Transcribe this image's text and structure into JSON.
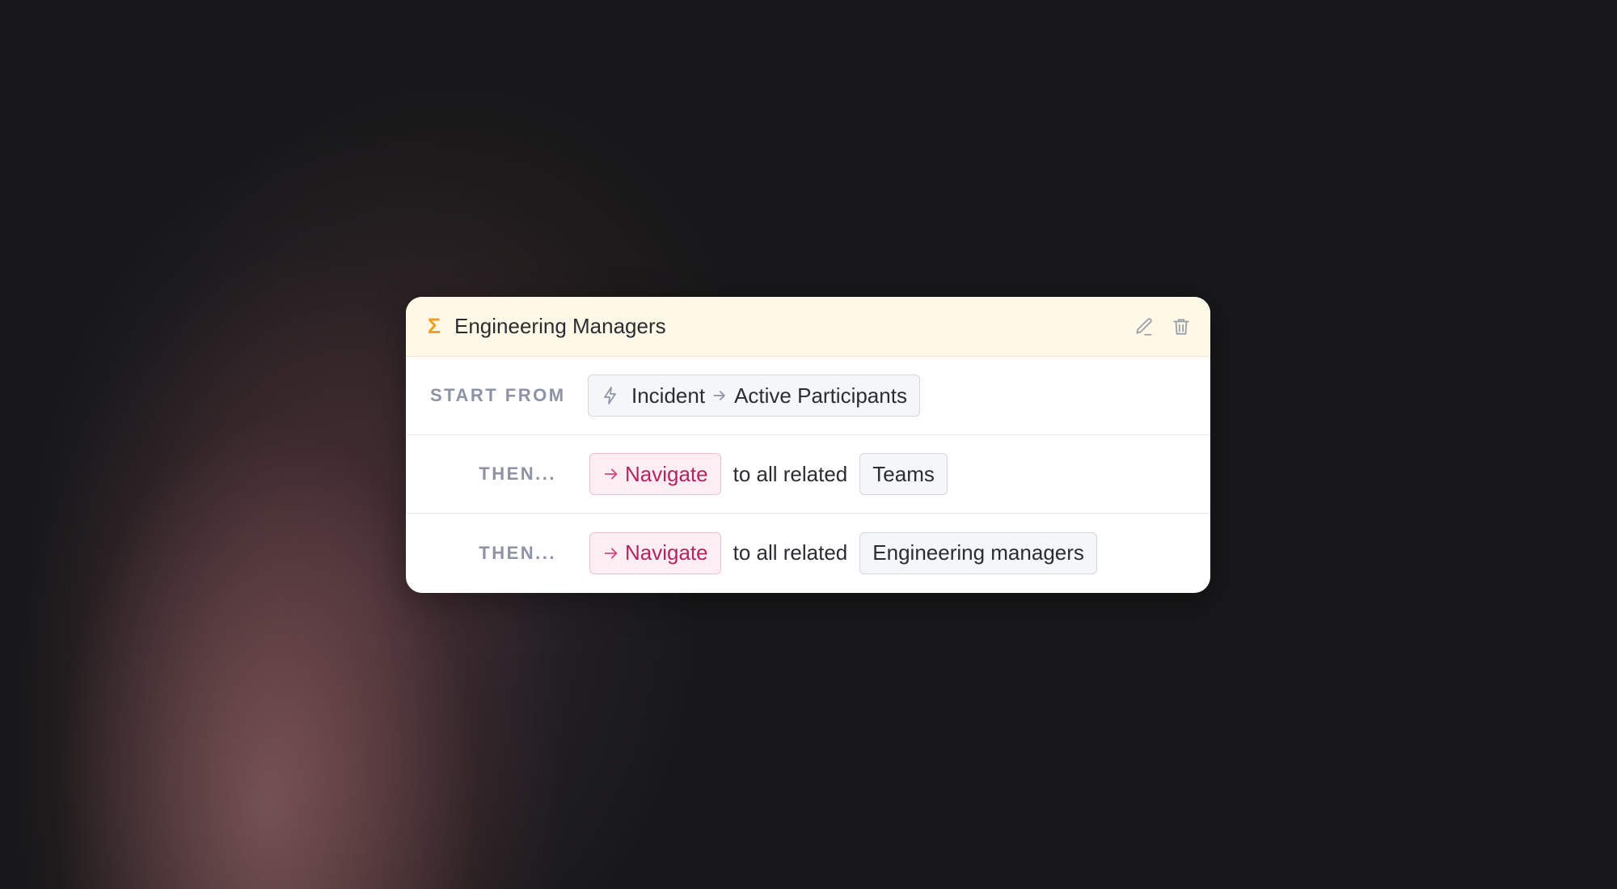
{
  "card": {
    "title": "Engineering Managers",
    "icons": {
      "title_icon": "sigma-icon",
      "edit": "pencil-icon",
      "delete": "trash-icon"
    }
  },
  "start": {
    "label": "START FROM",
    "source_icon": "lightning-bolt-icon",
    "source": "Incident",
    "arrow_icon": "arrow-right-icon",
    "target": "Active Participants"
  },
  "steps": [
    {
      "label": "THEN...",
      "action": "Navigate",
      "connector": "to all related",
      "target": "Teams"
    },
    {
      "label": "THEN...",
      "action": "Navigate",
      "connector": "to all related",
      "target": "Engineering managers"
    }
  ],
  "colors": {
    "header_bg": "#fef8e6",
    "sigma": "#f0a020",
    "navigate_text": "#b5245e",
    "navigate_bg": "#fdeef4",
    "label_gray": "#8d93a5"
  }
}
